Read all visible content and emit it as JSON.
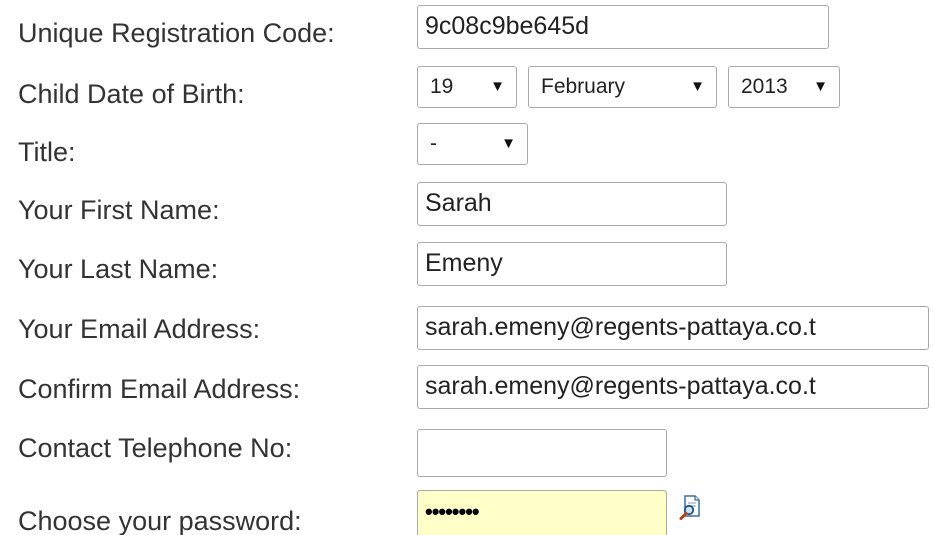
{
  "form": {
    "registration_code": {
      "label": "Unique Registration Code:",
      "value": "9c08c9be645d"
    },
    "dob": {
      "label": "Child Date of Birth:",
      "day": "19",
      "month": "February",
      "year": "2013"
    },
    "title": {
      "label": "Title:",
      "value": "-"
    },
    "first_name": {
      "label": "Your First Name:",
      "value": "Sarah"
    },
    "last_name": {
      "label": "Your Last Name:",
      "value": "Emeny"
    },
    "email": {
      "label": "Your Email Address:",
      "value": "sarah.emeny@regents-pattaya.co.t"
    },
    "confirm_email": {
      "label": "Confirm Email Address:",
      "value": "sarah.emeny@regents-pattaya.co.t"
    },
    "telephone": {
      "label": "Contact Telephone No:",
      "value": ""
    },
    "password": {
      "label": "Choose your password:",
      "masked_value": "••••••••",
      "reveal_icon": "magnifier-document-icon"
    }
  },
  "colors": {
    "password_bg": "#ffffc8",
    "field_border": "#a9a9a9",
    "label_text": "#333333"
  }
}
